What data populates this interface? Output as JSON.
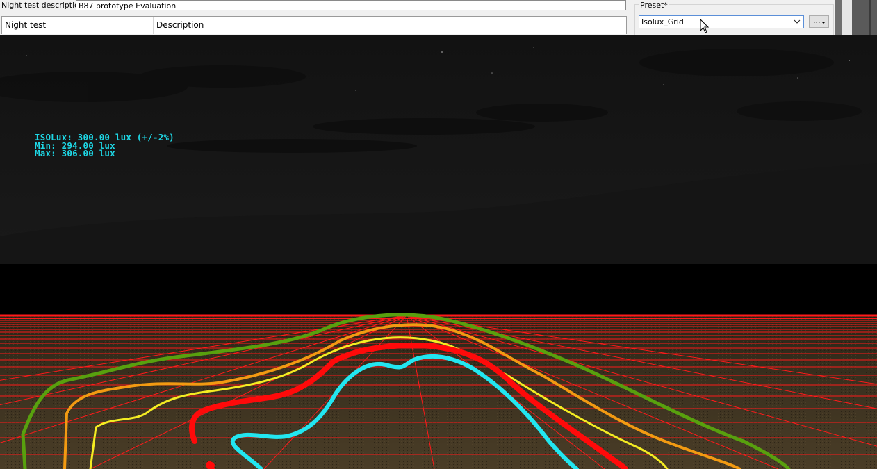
{
  "form": {
    "night_test_description_label": "Night test description",
    "night_test_description_value": "B87 prototype Evaluation",
    "columns": [
      "Night test",
      "Description"
    ]
  },
  "preset": {
    "label": "Preset*",
    "selected": "Isolux_Grid",
    "more_button": "..."
  },
  "viewport": {
    "isolux_readout": [
      "ISOLux: 300.00 lux (+/-2%)",
      "Min: 294.00 lux",
      "Max: 306.00 lux"
    ],
    "grid_color": "#ff1a1a",
    "readout_color": "#1ed8e6",
    "contour_colors": [
      "#58a00e",
      "#f29a12",
      "#f4ec22",
      "#ff0a0a",
      "#22e6f0"
    ]
  },
  "icons": {
    "preset_dropdown": "chevron-down-icon",
    "more_button_caret": "caret-down-icon",
    "mouse_cursor": "cursor-arrow-icon"
  }
}
